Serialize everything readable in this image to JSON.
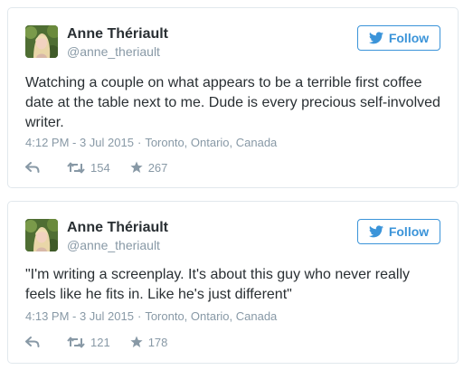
{
  "colors": {
    "accent": "#3b94d9",
    "text": "#292f33",
    "muted": "#8899a6",
    "border": "#e1e8ed"
  },
  "icons": {
    "follow": "twitter-bird-icon",
    "reply": "reply-arrow-icon",
    "retweet": "retweet-icon",
    "like": "star-icon"
  },
  "tweets": [
    {
      "author_name": "Anne Thériault",
      "author_handle": "@anne_theriault",
      "follow_label": "Follow",
      "text": "Watching a couple on what appears to be a terrible first coffee date at the table next to me. Dude is every precious self-involved writer.",
      "timestamp": "4:12 PM - 3 Jul 2015",
      "separator": "·",
      "location": "Toronto, Ontario, Canada",
      "retweets": "154",
      "likes": "267"
    },
    {
      "author_name": "Anne Thériault",
      "author_handle": "@anne_theriault",
      "follow_label": "Follow",
      "text": "\"I'm writing a screenplay. It's about this guy who never really feels like he fits in. Like he's just different\"",
      "timestamp": "4:13 PM - 3 Jul 2015",
      "separator": "·",
      "location": "Toronto, Ontario, Canada",
      "retweets": "121",
      "likes": "178"
    }
  ]
}
